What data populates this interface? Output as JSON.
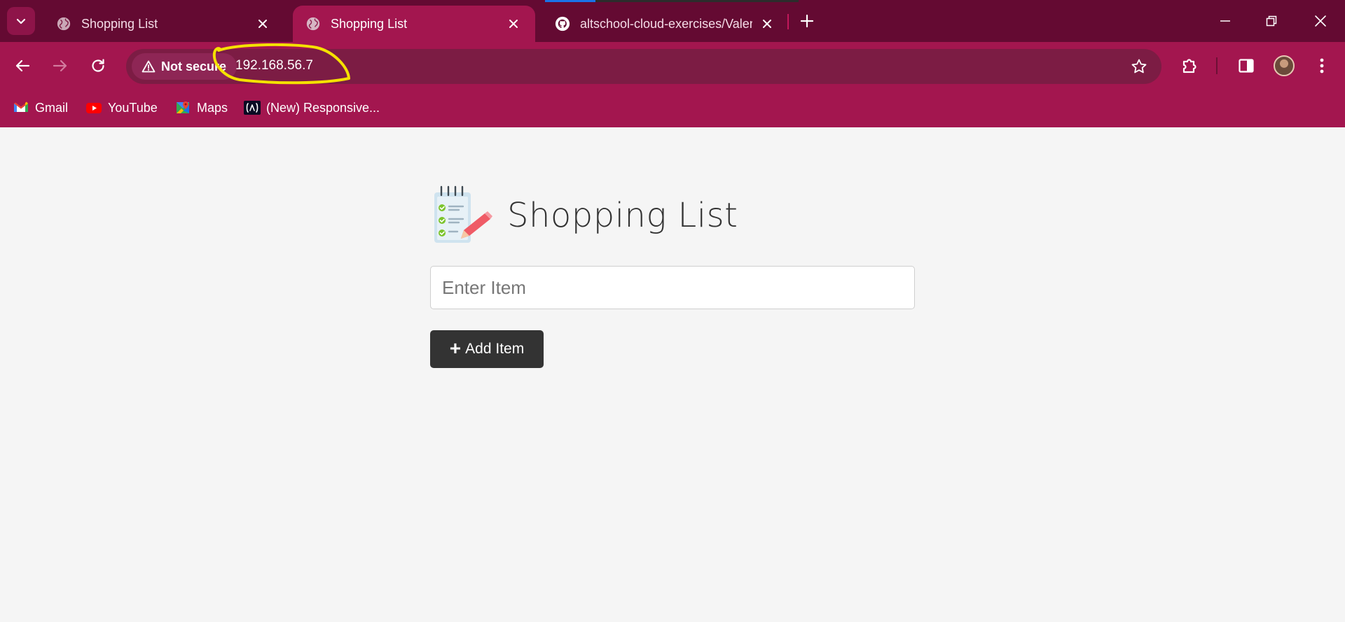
{
  "browser": {
    "tabs": [
      {
        "title": "Shopping List",
        "active": false
      },
      {
        "title": "Shopping List",
        "active": true
      },
      {
        "title": "altschool-cloud-exercises/Valen",
        "active": false
      }
    ],
    "address_bar": {
      "security_label": "Not secure",
      "url": "192.168.56.7"
    },
    "bookmarks": [
      {
        "label": "Gmail",
        "icon": "gmail-icon"
      },
      {
        "label": "YouTube",
        "icon": "youtube-icon"
      },
      {
        "label": "Maps",
        "icon": "maps-icon"
      },
      {
        "label": "(New) Responsive...",
        "icon": "responsive-icon"
      }
    ],
    "colors": {
      "tabstrip": "#640a32",
      "toolbar": "#a3164f",
      "highlight": "#f5e100"
    }
  },
  "page": {
    "title": "Shopping List",
    "input": {
      "placeholder": "Enter Item",
      "value": ""
    },
    "add_button": {
      "icon": "+",
      "label": "Add Item"
    }
  }
}
